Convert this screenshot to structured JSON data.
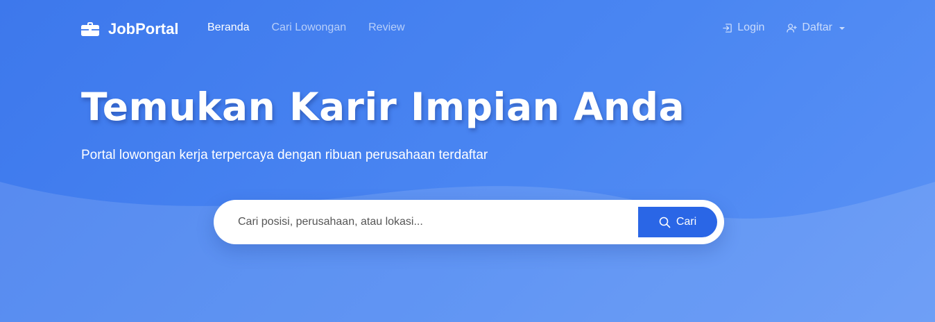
{
  "brand": {
    "name": "JobPortal",
    "icon": "briefcase-icon"
  },
  "nav": {
    "links": [
      {
        "label": "Beranda",
        "active": true
      },
      {
        "label": "Cari Lowongan",
        "active": false
      },
      {
        "label": "Review",
        "active": false
      }
    ],
    "login": {
      "label": "Login",
      "icon": "login-icon"
    },
    "register": {
      "label": "Daftar",
      "icon": "user-plus-icon"
    }
  },
  "hero": {
    "title": "Temukan Karir Impian Anda",
    "subtitle": "Portal lowongan kerja terpercaya dengan ribuan perusahaan terdaftar"
  },
  "search": {
    "placeholder": "Cari posisi, perusahaan, atau lokasi...",
    "value": "",
    "button_label": "Cari",
    "icon": "search-icon"
  },
  "colors": {
    "background": "#4a86f2",
    "button": "#2a66e6",
    "text": "#ffffff"
  }
}
